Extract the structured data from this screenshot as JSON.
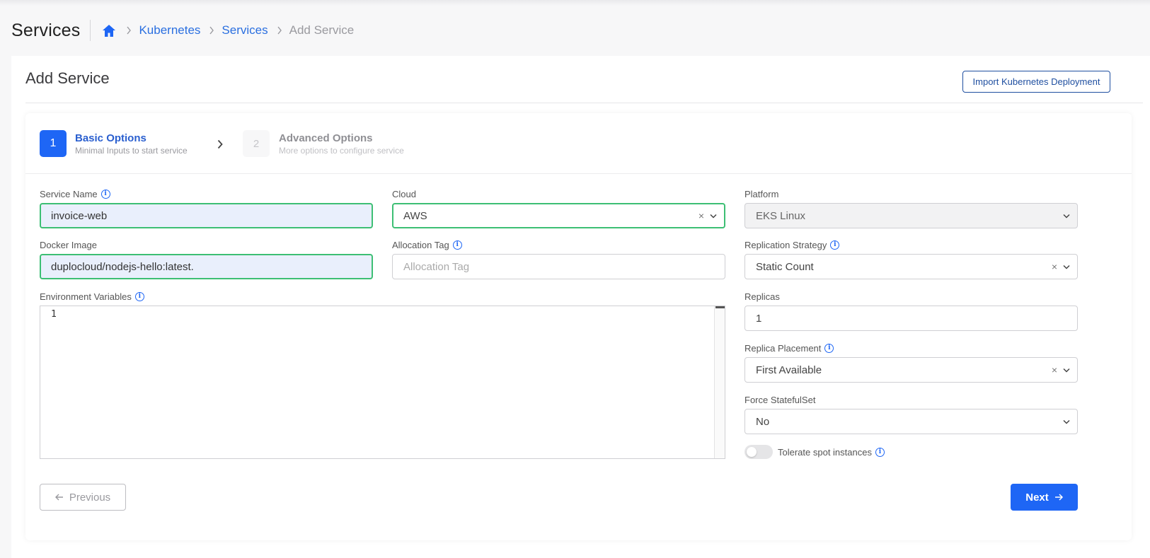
{
  "page": {
    "title": "Services",
    "breadcrumb": [
      "Kubernetes",
      "Services"
    ],
    "breadcrumb_current": "Add Service"
  },
  "card": {
    "title": "Add Service",
    "import_button": "Import Kubernetes Deployment"
  },
  "steps": [
    {
      "number": "1",
      "title": "Basic Options",
      "subtitle": "Minimal Inputs to start service",
      "active": true
    },
    {
      "number": "2",
      "title": "Advanced Options",
      "subtitle": "More options to configure service",
      "active": false
    }
  ],
  "form": {
    "service_name": {
      "label": "Service Name",
      "value": "invoice-web"
    },
    "cloud": {
      "label": "Cloud",
      "value": "AWS"
    },
    "platform": {
      "label": "Platform",
      "value": "EKS Linux"
    },
    "docker_image": {
      "label": "Docker Image",
      "value": "duplocloud/nodejs-hello:latest."
    },
    "allocation_tag": {
      "label": "Allocation Tag",
      "placeholder": "Allocation Tag"
    },
    "replication_strategy": {
      "label": "Replication Strategy",
      "value": "Static Count"
    },
    "environment_variables": {
      "label": "Environment Variables",
      "line_number": "1"
    },
    "replicas": {
      "label": "Replicas",
      "value": "1"
    },
    "replica_placement": {
      "label": "Replica Placement",
      "value": "First Available"
    },
    "force_statefulset": {
      "label": "Force StatefulSet",
      "value": "No"
    },
    "tolerate_spot": {
      "label": "Tolerate spot instances",
      "enabled": false
    }
  },
  "buttons": {
    "previous": "Previous",
    "next": "Next"
  },
  "colors": {
    "primary": "#1e66f5",
    "link": "#2a6fe0",
    "valid_border": "#3dbf74",
    "valid_fill": "#e9effc"
  }
}
